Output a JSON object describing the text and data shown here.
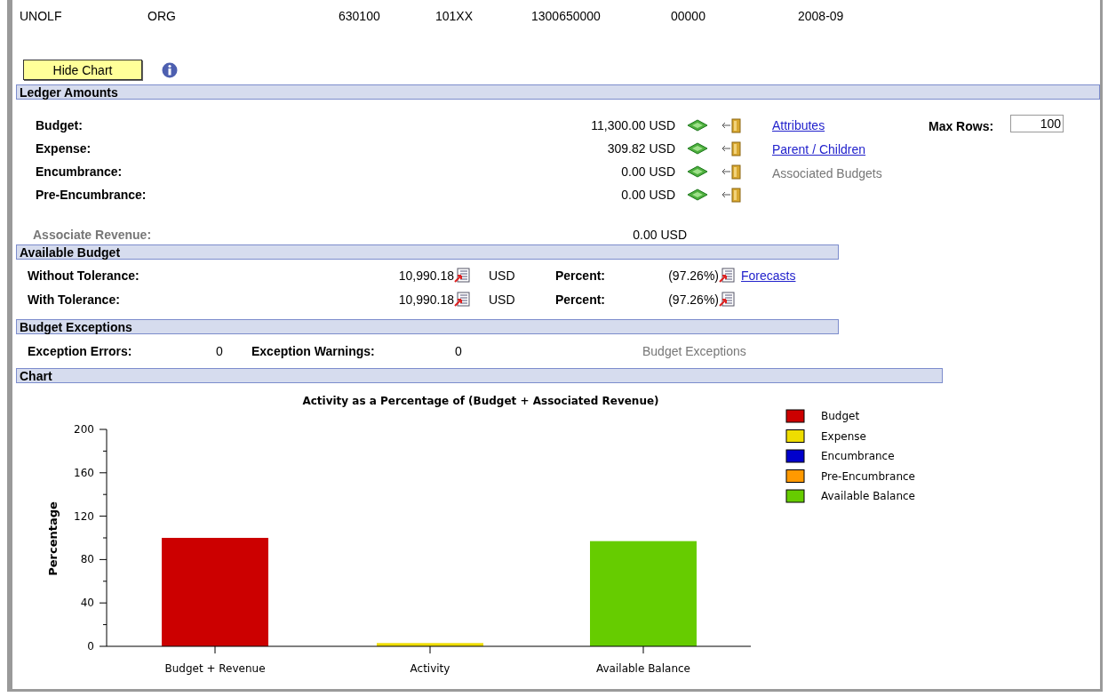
{
  "header_fields": [
    "UNOLF",
    "ORG",
    "630100",
    "101XX",
    "1300650000",
    "00000",
    "2008-09"
  ],
  "hide_chart_button": "Hide Chart",
  "ledger_amounts": {
    "title": "Ledger Amounts",
    "rows": [
      {
        "label": "Budget:",
        "amount": "11,300.00 USD"
      },
      {
        "label": "Expense:",
        "amount": "309.82 USD"
      },
      {
        "label": "Encumbrance:",
        "amount": "0.00 USD"
      },
      {
        "label": "Pre-Encumbrance:",
        "amount": "0.00 USD"
      }
    ],
    "links": [
      {
        "label": "Attributes",
        "disabled": false
      },
      {
        "label": "Parent / Children",
        "disabled": false
      },
      {
        "label": "Associated Budgets",
        "disabled": true
      }
    ],
    "max_rows": {
      "label": "Max Rows:",
      "value": "100"
    },
    "associate_revenue": {
      "label": "Associate Revenue:",
      "amount": "0.00 USD"
    }
  },
  "available_budget": {
    "title": "Available Budget",
    "rows": [
      {
        "label": "Without Tolerance:",
        "amount": "10,990.18",
        "currency": "USD",
        "percent_label": "Percent:",
        "percent": "(97.26%)",
        "link": "Forecasts"
      },
      {
        "label": "With Tolerance:",
        "amount": "10,990.18",
        "currency": "USD",
        "percent_label": "Percent:",
        "percent": "(97.26%)"
      }
    ]
  },
  "budget_exceptions": {
    "title": "Budget Exceptions",
    "errors_label": "Exception Errors:",
    "errors": "0",
    "warnings_label": "Exception Warnings:",
    "warnings": "0",
    "link": {
      "label": "Budget Exceptions",
      "disabled": true
    }
  },
  "chart": {
    "title": "Chart",
    "chart_data": {
      "type": "bar",
      "title": "Activity as a Percentage of (Budget + Associated Revenue)",
      "ylabel": "Percentage",
      "categories": [
        "Budget + Revenue",
        "Activity",
        "Available Balance"
      ],
      "stacked": true,
      "legend": true,
      "ylim": [
        0,
        200
      ],
      "yticks": [
        0,
        40,
        80,
        120,
        160,
        200
      ],
      "series": [
        {
          "name": "Budget",
          "color": "#cc0000",
          "values": [
            100,
            null,
            null
          ]
        },
        {
          "name": "Expense",
          "color": "#eedd00",
          "values": [
            null,
            3,
            null
          ]
        },
        {
          "name": "Encumbrance",
          "color": "#0000cc",
          "values": [
            null,
            0,
            null
          ]
        },
        {
          "name": "Pre-Encumbrance",
          "color": "#ff9900",
          "values": [
            null,
            0,
            null
          ]
        },
        {
          "name": "Available Balance",
          "color": "#66cc00",
          "values": [
            null,
            null,
            97
          ]
        }
      ]
    }
  }
}
